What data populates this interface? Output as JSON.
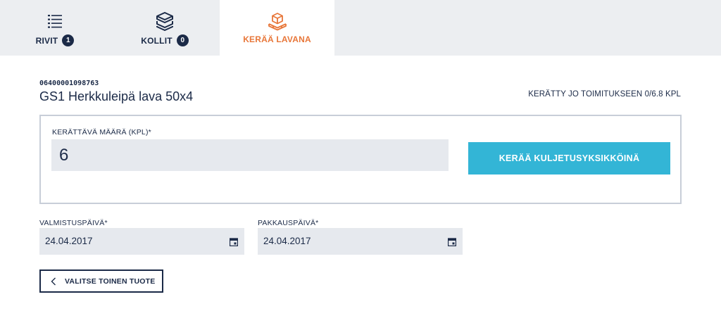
{
  "tabs": [
    {
      "label": "RIVIT",
      "badge": "1",
      "icon": "list-icon",
      "active": false
    },
    {
      "label": "KOLLIT",
      "badge": "0",
      "icon": "boxes-icon",
      "active": false
    },
    {
      "label": "KERÄÄ LAVANA",
      "icon": "pallet-icon",
      "active": true
    }
  ],
  "product": {
    "code": "06400001098763",
    "name": "GS1 Herkkuleipä lava 50x4",
    "collected_status": "KERÄTTY JO TOIMITUKSEEN 0/6.8 KPL"
  },
  "quantity": {
    "label": "KERÄTTÄVÄ MÄÄRÄ (KPL)*",
    "value": "6"
  },
  "collect_button_label": "KERÄÄ KULJETUSYKSIKKÖINÄ",
  "manufacture_date": {
    "label": "VALMISTUSPÄIVÄ*",
    "value": "24.04.2017"
  },
  "packing_date": {
    "label": "PAKKAUSPÄIVÄ*",
    "value": "24.04.2017"
  },
  "choose_other_label": "VALITSE TOINEN TUOTE",
  "colors": {
    "navy": "#1b2a47",
    "accent_orange": "#e8773a",
    "button_cyan": "#33b5d6",
    "tabbar_bg": "#eceef1",
    "input_bg": "#e6e9ee"
  }
}
